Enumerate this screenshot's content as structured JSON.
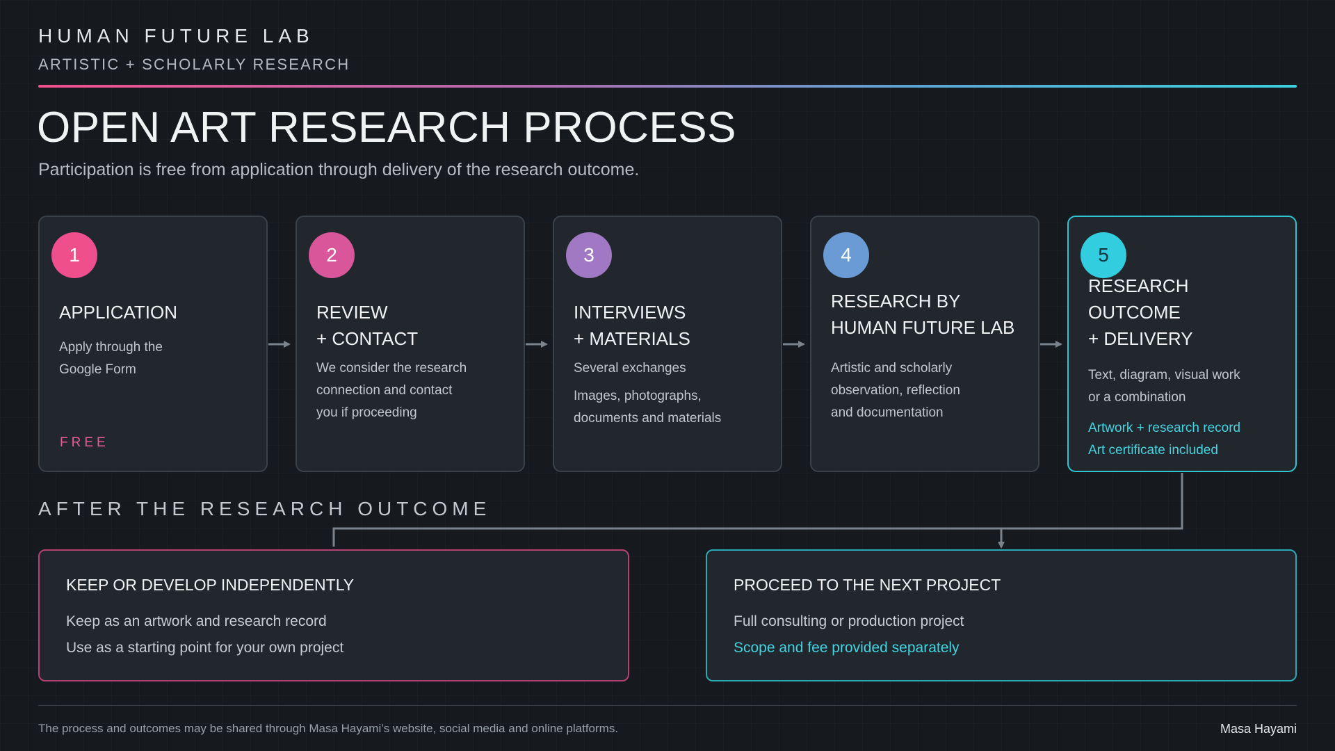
{
  "header": {
    "lab_name": "HUMAN FUTURE LAB",
    "lab_subtitle": "ARTISTIC + SCHOLARLY RESEARCH",
    "title": "OPEN ART RESEARCH PROCESS",
    "subtitle": "Participation is free from application through delivery of the research outcome."
  },
  "steps": [
    {
      "number": "1",
      "title": [
        "APPLICATION"
      ],
      "desc": [
        "Apply through the",
        "Google Form"
      ],
      "badge": "FREE",
      "color": "#ef4f8a"
    },
    {
      "number": "2",
      "title": [
        "REVIEW",
        "+ CONTACT"
      ],
      "desc": [
        "We consider the research",
        "connection and contact",
        "you if proceeding"
      ],
      "color": "#d85699"
    },
    {
      "number": "3",
      "title": [
        "INTERVIEWS",
        "+ MATERIALS"
      ],
      "desc_a": "Several exchanges",
      "desc_b": [
        "Images, photographs,",
        "documents and materials"
      ],
      "color": "#a078c4"
    },
    {
      "number": "4",
      "title": [
        "RESEARCH BY",
        "HUMAN FUTURE LAB"
      ],
      "desc": [
        "Artistic and scholarly",
        "observation, reflection",
        "and documentation"
      ],
      "color": "#6a9bd4"
    },
    {
      "number": "5",
      "title": [
        "RESEARCH",
        "OUTCOME",
        "+ DELIVERY"
      ],
      "desc": [
        "Text, diagram, visual work",
        "or a combination"
      ],
      "note": [
        "Artwork + research record",
        "Art certificate included"
      ],
      "color": "#33cde0"
    }
  ],
  "after": {
    "label": "AFTER THE RESEARCH OUTCOME",
    "keep": {
      "title": "KEEP OR DEVELOP INDEPENDENTLY",
      "lines": [
        "Keep as an artwork and research record",
        "Use as a starting point for your own project"
      ],
      "border_color": "#b6426f"
    },
    "proceed": {
      "title": "PROCEED TO THE NEXT PROJECT",
      "line": "Full consulting or production project",
      "accent_line": "Scope and fee provided separately",
      "border_color": "#2aa9b6"
    }
  },
  "footer": {
    "note": "The process and outcomes may be shared through Masa Hayami’s website, social media and online platforms.",
    "author": "Masa Hayami"
  },
  "colors": {
    "background": "#161a1f",
    "card": "#22272e",
    "card_border": "#3b4148",
    "accent_teal": "#43d3e1",
    "accent_pink": "#ef5a92",
    "connector": "#7b838c"
  }
}
